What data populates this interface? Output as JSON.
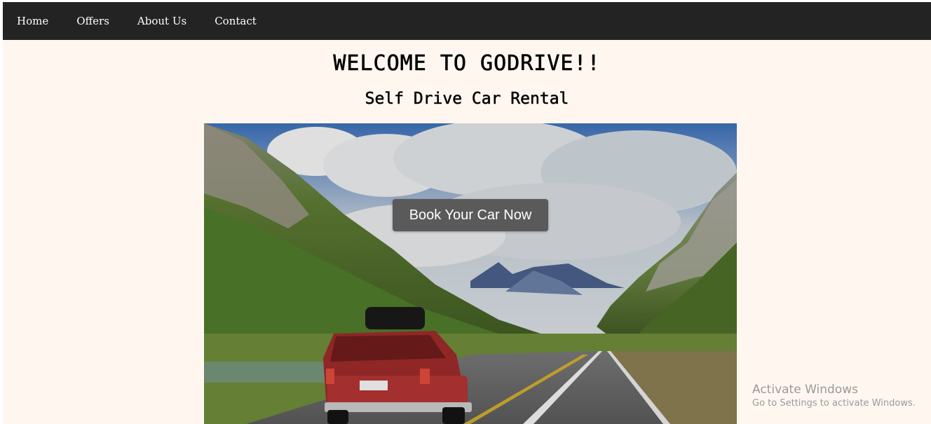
{
  "nav": {
    "items": [
      {
        "label": "Home"
      },
      {
        "label": "Offers"
      },
      {
        "label": "About Us"
      },
      {
        "label": "Contact"
      }
    ]
  },
  "hero": {
    "title": "WELCOME TO GODRIVE!!",
    "subtitle": "Self Drive Car Rental",
    "cta_label": "Book Your Car Now"
  },
  "watermark": {
    "title": "Activate Windows",
    "subtitle": "Go to Settings to activate Windows."
  },
  "colors": {
    "navbar": "#232323",
    "page_background": "#fff7ef",
    "cta_background": "#5a5a5a"
  }
}
